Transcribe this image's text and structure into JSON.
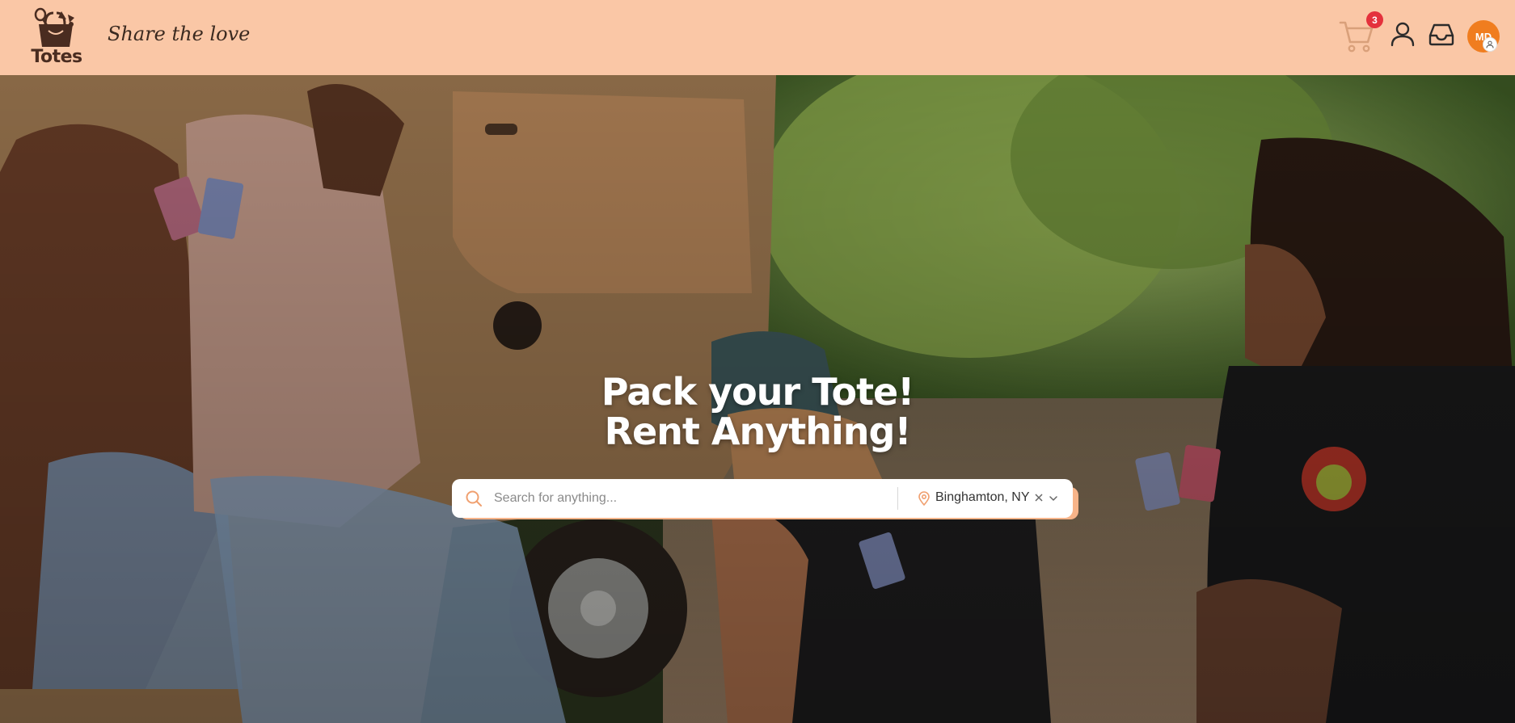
{
  "brand": {
    "name": "Totes",
    "tagline": "Share the love"
  },
  "header": {
    "cart_count": "3",
    "avatar_initials": "MD",
    "icons": [
      "cart-icon",
      "user-icon",
      "inbox-icon",
      "avatar-user-icon"
    ]
  },
  "hero": {
    "title_line1": "Pack your Tote!",
    "title_line2": "Rent Anything!",
    "search": {
      "placeholder": "Search for anything...",
      "value": ""
    },
    "location": {
      "value": "Binghamton, NY"
    }
  },
  "colors": {
    "header_bg": "#fac7a6",
    "accent": "#f07d1f",
    "badge": "#e4313c",
    "search_shadow": "#f7b489"
  }
}
